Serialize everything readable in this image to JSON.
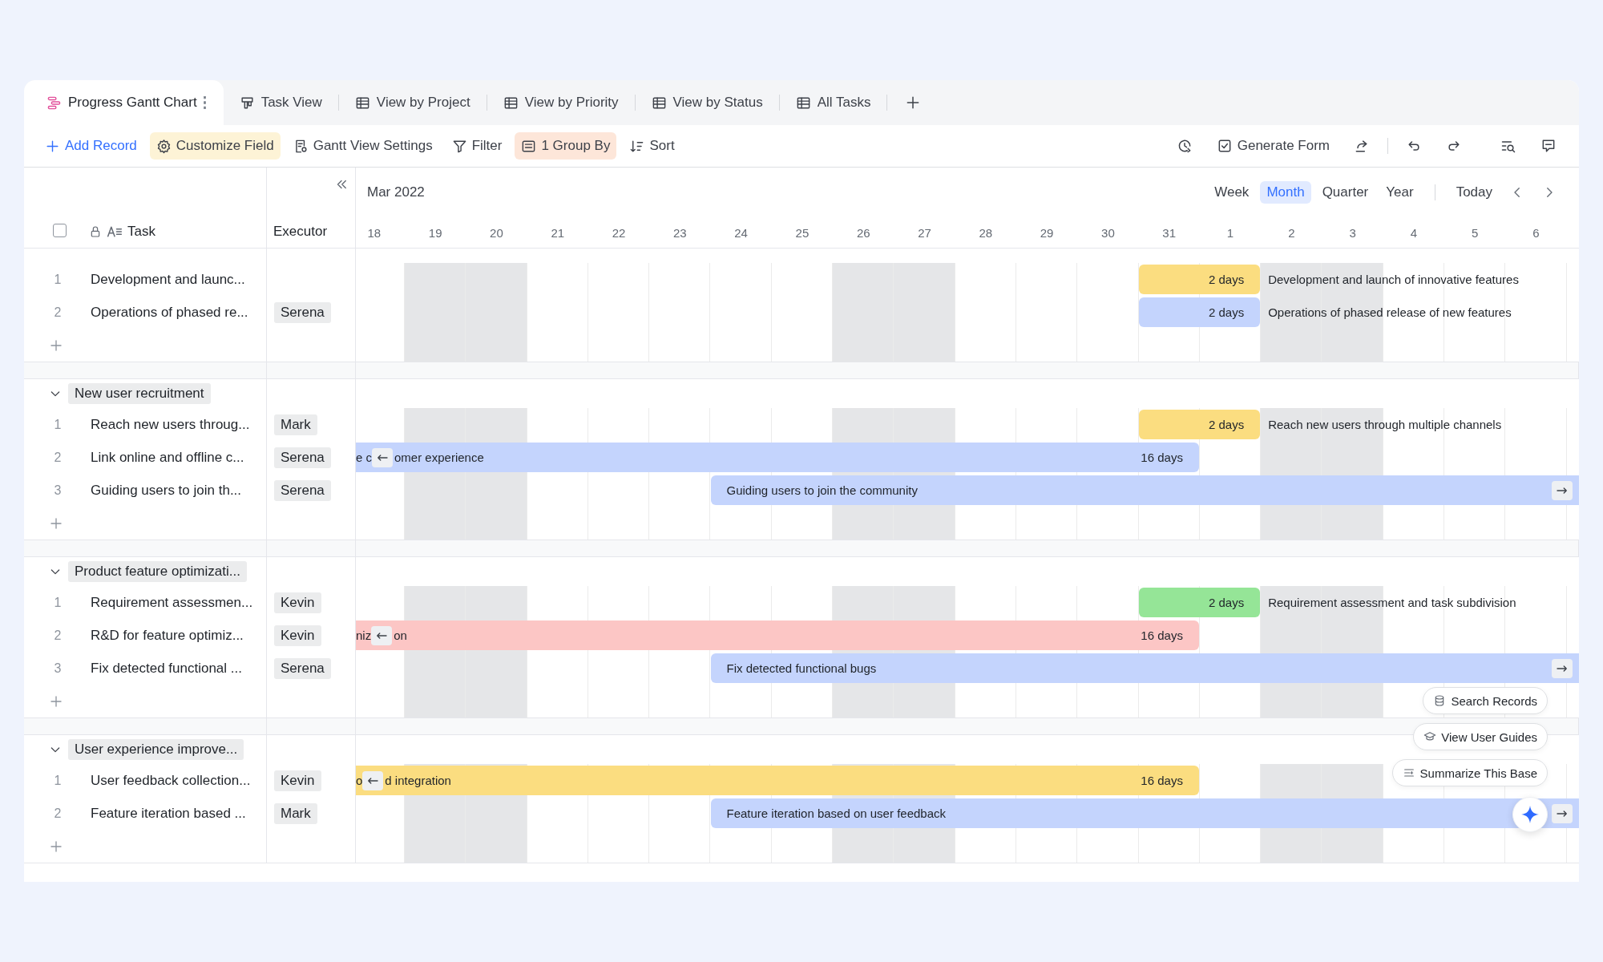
{
  "tabs": [
    {
      "label": "Progress Gantt Chart",
      "kind": "gantt",
      "selected": true
    },
    {
      "label": "Task View",
      "kind": "board",
      "selected": false
    },
    {
      "label": "View by Project",
      "kind": "table",
      "selected": false
    },
    {
      "label": "View by Priority",
      "kind": "table",
      "selected": false
    },
    {
      "label": "View by Status",
      "kind": "table",
      "selected": false
    },
    {
      "label": "All Tasks",
      "kind": "table",
      "selected": false
    }
  ],
  "toolbar": {
    "actions": [
      {
        "kind": "add",
        "label": "Add Record"
      },
      {
        "kind": "customize",
        "label": "Customize Field",
        "active": true
      },
      {
        "kind": "settings",
        "label": "Gantt View Settings",
        "active": false
      },
      {
        "kind": "filter",
        "label": "Filter",
        "active": false
      },
      {
        "kind": "group",
        "label": "1 Group By",
        "active": true
      },
      {
        "kind": "sort",
        "label": "Sort",
        "active": false
      }
    ],
    "tools": [
      {
        "kind": "history"
      },
      {
        "kind": "form",
        "label": "Generate Form"
      },
      {
        "kind": "share"
      },
      {
        "kind": "undo"
      },
      {
        "kind": "redo"
      },
      {
        "kind": "find"
      },
      {
        "kind": "comment"
      }
    ]
  },
  "grid": {
    "columns": [
      "Task",
      "Executor"
    ],
    "all_checked": false
  },
  "timeline": {
    "month": "Mar 2022",
    "scales": [
      {
        "label": "Week",
        "selected": false
      },
      {
        "label": "Month",
        "selected": true
      },
      {
        "label": "Quarter",
        "selected": false
      },
      {
        "label": "Year",
        "selected": false
      }
    ],
    "today": "Today",
    "days": [
      {
        "label": "18",
        "weekend": false
      },
      {
        "label": "19",
        "weekend": true
      },
      {
        "label": "20",
        "weekend": true
      },
      {
        "label": "21",
        "weekend": false
      },
      {
        "label": "22",
        "weekend": false
      },
      {
        "label": "23",
        "weekend": false
      },
      {
        "label": "24",
        "weekend": false
      },
      {
        "label": "25",
        "weekend": false
      },
      {
        "label": "26",
        "weekend": true
      },
      {
        "label": "27",
        "weekend": true
      },
      {
        "label": "28",
        "weekend": false
      },
      {
        "label": "29",
        "weekend": false
      },
      {
        "label": "30",
        "weekend": false
      },
      {
        "label": "31",
        "weekend": false
      },
      {
        "label": "1",
        "weekend": false
      },
      {
        "label": "2",
        "weekend": true
      },
      {
        "label": "3",
        "weekend": true
      },
      {
        "label": "4",
        "weekend": false
      },
      {
        "label": "5",
        "weekend": false
      },
      {
        "label": "6",
        "weekend": false
      }
    ]
  },
  "groups": [
    {
      "tasks": [
        {
          "number": "1",
          "name": "Development and launc...",
          "bar": {
            "kind": "short",
            "color": "#fbdd80",
            "duration": "2 days",
            "title": "Development and launch of innovative features"
          }
        },
        {
          "number": "2",
          "name": "Operations of phased re...",
          "executor": "Serena",
          "bar": {
            "kind": "short",
            "color": "#c4d4fd",
            "duration": "2 days",
            "title": "Operations of phased release of new features"
          }
        }
      ]
    },
    {
      "name": "New user recruitment",
      "expanded": true,
      "tasks": [
        {
          "number": "1",
          "name": "Reach new users throug...",
          "executor": "Mark",
          "bar": {
            "kind": "short",
            "color": "#fbdd80",
            "duration": "2 days",
            "title": "Reach new users through multiple channels"
          }
        },
        {
          "number": "2",
          "name": "Link online and offline c...",
          "executor": "Serena",
          "bar": {
            "kind": "overdue",
            "color": "#c4d4fd",
            "duration": "16 days",
            "title_left": "e c",
            "title": "omer experience"
          }
        },
        {
          "number": "3",
          "name": "Guiding users to join th...",
          "executor": "Serena",
          "bar": {
            "kind": "ongoing",
            "color": "#c4d4fd",
            "title": "Guiding users to join the community"
          }
        }
      ]
    },
    {
      "name": "Product feature optimizati...",
      "expanded": true,
      "tasks": [
        {
          "number": "1",
          "name": "Requirement assessmen...",
          "executor": "Kevin",
          "bar": {
            "kind": "short",
            "color": "#95e597",
            "duration": "2 days",
            "title": "Requirement assessment and task subdivision"
          }
        },
        {
          "number": "2",
          "name": "R&D for feature optimiz...",
          "executor": "Kevin",
          "bar": {
            "kind": "overdue",
            "color": "#fcc6c5",
            "duration": "16 days",
            "title_left": "niz",
            "title": "on"
          }
        },
        {
          "number": "3",
          "name": "Fix detected functional ...",
          "executor": "Serena",
          "bar": {
            "kind": "ongoing",
            "color": "#c4d4fd",
            "title": "Fix detected functional bugs"
          }
        }
      ]
    },
    {
      "name": "User experience improve...",
      "expanded": true,
      "tasks": [
        {
          "number": "1",
          "name": "User feedback collection...",
          "executor": "Kevin",
          "bar": {
            "kind": "overdue",
            "color": "#fbdd80",
            "duration": "16 days",
            "title_left": "o",
            "title": "d integration"
          }
        },
        {
          "number": "2",
          "name": "Feature iteration based ...",
          "executor": "Mark",
          "bar": {
            "kind": "ongoing",
            "color": "#c4d4fd",
            "title": "Feature iteration based on user feedback"
          }
        }
      ]
    }
  ],
  "assistant": {
    "actions": [
      {
        "kind": "search",
        "label": "Search Records"
      },
      {
        "kind": "guide",
        "label": "View User Guides"
      },
      {
        "kind": "summary",
        "label": "Summarize This Base"
      }
    ]
  }
}
